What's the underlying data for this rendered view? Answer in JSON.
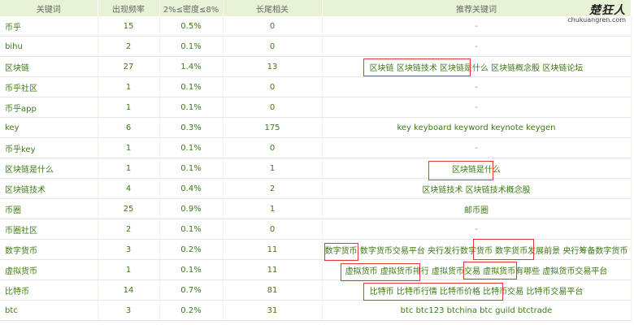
{
  "headers": [
    "关键词",
    "出现频率",
    "2%≤密度≤8%",
    "长尾相关",
    "推荐关键词"
  ],
  "rows": [
    {
      "kw": "币乎",
      "freq": "15",
      "density": "0.5%",
      "longtail": "0",
      "rec": "-"
    },
    {
      "kw": "bihu",
      "freq": "2",
      "density": "0.1%",
      "longtail": "0",
      "rec": "-"
    },
    {
      "kw": "区块链",
      "freq": "27",
      "density": "1.4%",
      "longtail": "13",
      "rec": "区块链 区块链技术 区块链是什么 区块链概念股 区块链论坛"
    },
    {
      "kw": "币乎社区",
      "freq": "1",
      "density": "0.1%",
      "longtail": "0",
      "rec": "-"
    },
    {
      "kw": "币乎app",
      "freq": "1",
      "density": "0.1%",
      "longtail": "0",
      "rec": "-"
    },
    {
      "kw": "key",
      "freq": "6",
      "density": "0.3%",
      "longtail": "175",
      "rec": "key keyboard keyword keynote keygen"
    },
    {
      "kw": "币乎key",
      "freq": "1",
      "density": "0.1%",
      "longtail": "0",
      "rec": "-"
    },
    {
      "kw": "区块链是什么",
      "freq": "1",
      "density": "0.1%",
      "longtail": "1",
      "rec": "区块链是什么"
    },
    {
      "kw": "区块链技术",
      "freq": "4",
      "density": "0.4%",
      "longtail": "2",
      "rec": "区块链技术 区块链技术概念股"
    },
    {
      "kw": "币圈",
      "freq": "25",
      "density": "0.9%",
      "longtail": "1",
      "rec": "邮币圈"
    },
    {
      "kw": "币圈社区",
      "freq": "2",
      "density": "0.1%",
      "longtail": "0",
      "rec": "-"
    },
    {
      "kw": "数字货币",
      "freq": "3",
      "density": "0.2%",
      "longtail": "11",
      "rec": "数字货币 数字货币交易平台 央行发行数字货币 数字货币发展前景 央行筹备数字货币"
    },
    {
      "kw": "虚拟货币",
      "freq": "1",
      "density": "0.1%",
      "longtail": "11",
      "rec": "虚拟货币 虚拟货币排行 虚拟货币交易 虚拟货币有哪些 虚拟货币交易平台"
    },
    {
      "kw": "比特币",
      "freq": "14",
      "density": "0.7%",
      "longtail": "81",
      "rec": "比特币 比特币行情 比特币价格 比特币交易 比特币交易平台"
    },
    {
      "kw": "btc",
      "freq": "3",
      "density": "0.2%",
      "longtail": "31",
      "rec": "btc btc123 btchina btc guild btctrade"
    }
  ],
  "watermark": {
    "mark": "楚狂人",
    "url": "chukuangren.com"
  },
  "colors": {
    "header_bg": "#e8f3d6",
    "text": "#3b7a12",
    "highlight_box": "#e53935"
  }
}
